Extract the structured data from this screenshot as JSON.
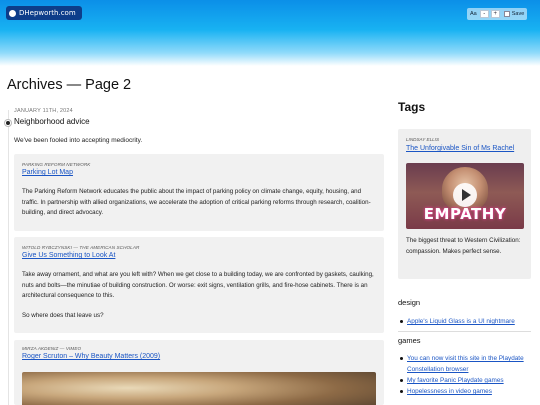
{
  "header": {
    "site_name": "DHepworth.com",
    "text_size_label": "Aa",
    "decrease_label": "-",
    "increase_label": "+",
    "save_label": "Save"
  },
  "page": {
    "title": "Archives — Page 2"
  },
  "post": {
    "date": "JANUARY 11TH, 2024",
    "title": "Neighborhood advice",
    "lede": "We've been fooled into accepting mediocrity."
  },
  "cards": [
    {
      "source": "PARKING REFORM NETWORK",
      "link": "Parking Lot Map",
      "paragraphs": [
        "The Parking Reform Network educates the public about the impact of parking policy on climate change, equity, housing, and traffic. In partnership with allied organizations, we accelerate the adoption of critical parking reforms through research, coalition-building, and direct advocacy."
      ]
    },
    {
      "source": "WITOLD RYBCZYNSKI — THE AMERICAN SCHOLAR",
      "link": "Give Us Something to Look At",
      "paragraphs": [
        "Take away ornament, and what are you left with? When we get close to a building today, we are confronted by gaskets, caulking, nuts and bolts—the minutiae of building construction. Or worse: exit signs, ventilation grills, and fire-hose cabinets. There is an architectural consequence to this.",
        "So where does that leave us?"
      ]
    },
    {
      "source": "MIRZA AKDENIZ — VIMEO",
      "link": "Roger Scruton – Why Beauty Matters (2009)"
    }
  ],
  "sidebar": {
    "tags_heading": "Tags",
    "featured": {
      "source": "LINDSAY ELLIS",
      "link": "The Unforgivable Sin of Ms Rachel",
      "thumbnail_word": "EMPATHY",
      "text": "The biggest threat to Western Civilization: compassion. Makes perfect sense."
    },
    "sections": [
      {
        "name": "design",
        "items": [
          "Apple's Liquid Glass is a UI nightmare"
        ]
      },
      {
        "name": "games",
        "items": [
          "You can now visit this site in the Playdate Constellation browser",
          "My favorite Panic Playdate games",
          "Hopelessness in video games"
        ]
      }
    ]
  },
  "colors": {
    "banner_top": "#0b8fe8",
    "badge": "#0d3d8a",
    "link": "#1a55c4",
    "card_bg": "#f1f1f1"
  },
  "icons": [
    "site-logo-dot-icon",
    "timeline-dot-icon",
    "play-icon",
    "bullet-icon"
  ]
}
